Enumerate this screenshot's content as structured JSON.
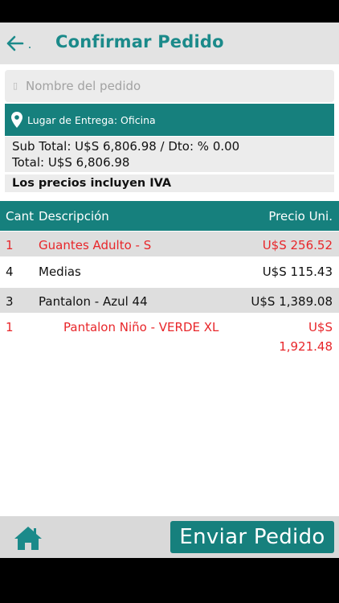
{
  "appbar": {
    "title": "Confirmar Pedido",
    "back_icon": "arrow-left-icon",
    "colors": {
      "accent": "#1b8a8a",
      "background": "#e3e3e3"
    }
  },
  "order_name": {
    "placeholder": "Nombre del pedido",
    "value": ""
  },
  "delivery": {
    "label": "Lugar de Entrega: Oficina",
    "icon": "map-pin-icon"
  },
  "totals": {
    "subtotal_line": "Sub Total: U$S 6,806.98 / Dto: % 0.00",
    "total_line": "Total: U$S 6,806.98"
  },
  "iva_note": "Los precios incluyen IVA",
  "table": {
    "headers": {
      "qty": "Cant",
      "description": "Descripción",
      "price": "Precio Uni."
    },
    "rows": [
      {
        "qty": "1",
        "description": "Guantes Adulto - S",
        "price": "U$S 256.52",
        "color": "#e8262a"
      },
      {
        "qty": "4",
        "description": "Medias",
        "price": "U$S 115.43",
        "color": "#111111"
      },
      {
        "qty": "3",
        "description": "Pantalon - Azul 44",
        "price": "U$S 1,389.08",
        "color": "#111111"
      },
      {
        "qty": "1",
        "description": "Pantalon Niño - VERDE XL",
        "price_line1": "U$S",
        "price_line2": "1,921.48",
        "color": "#e8262a"
      }
    ]
  },
  "bottombar": {
    "home_icon": "home-icon",
    "send_label": "Enviar Pedido"
  },
  "colors": {
    "teal": "#16807d",
    "red": "#e8262a"
  }
}
